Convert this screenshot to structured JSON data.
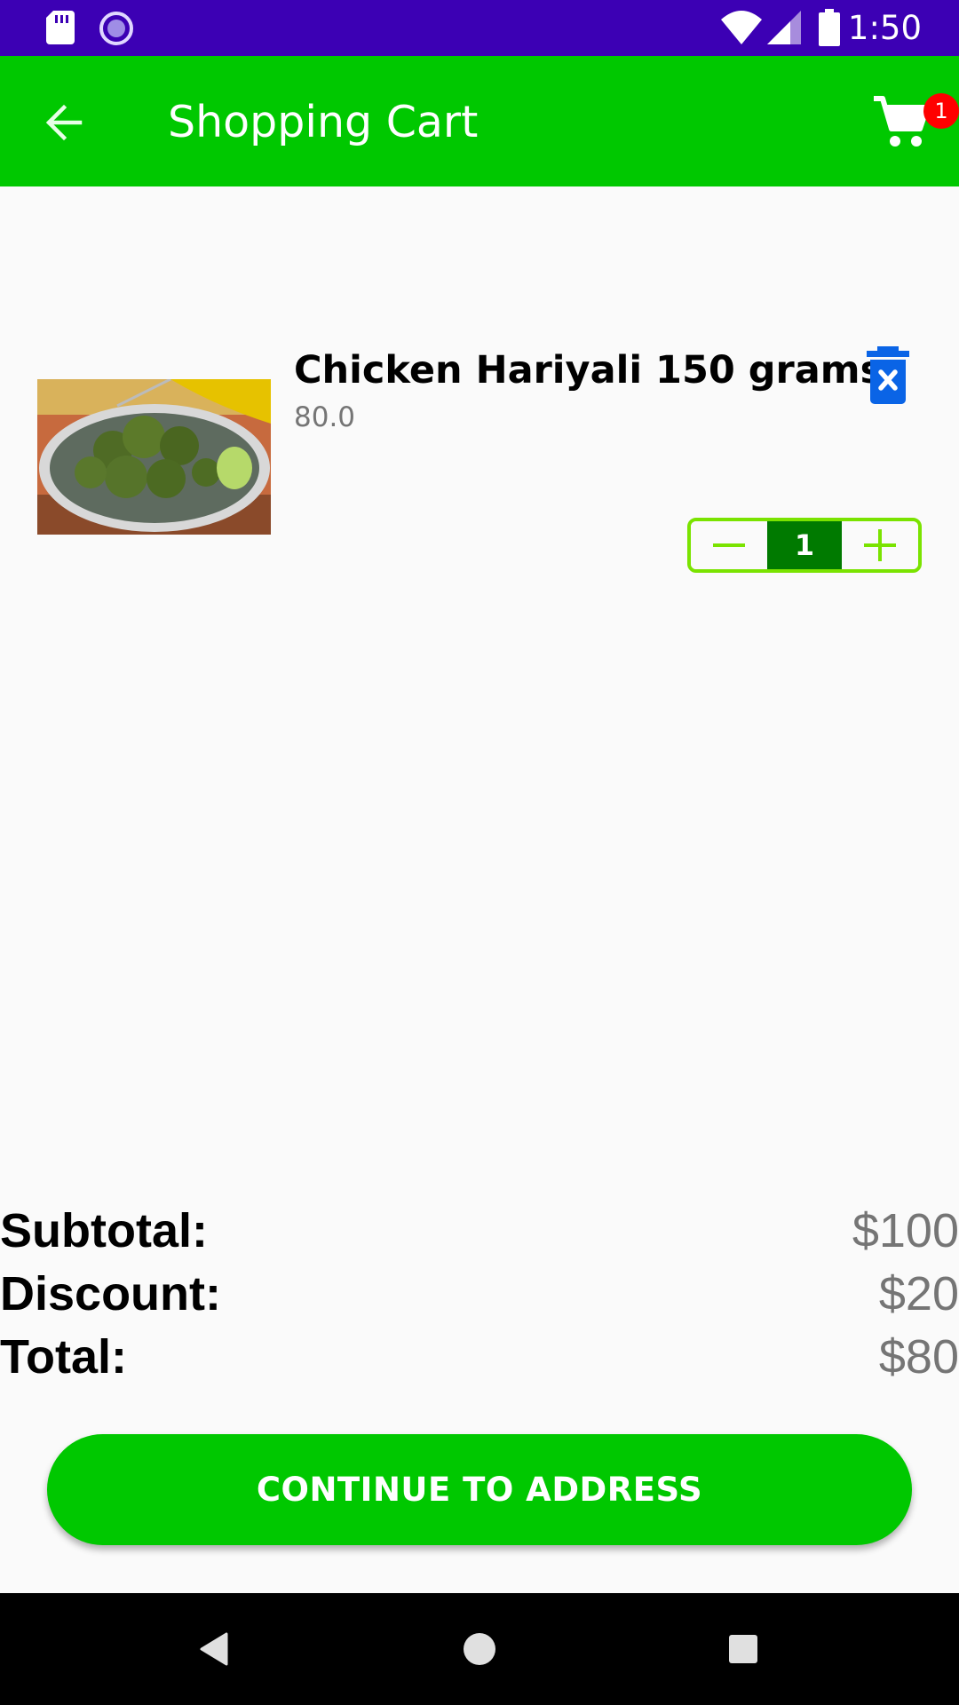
{
  "status_bar": {
    "time": "1:50",
    "icons": [
      "sd-card-icon",
      "sync-icon",
      "wifi-icon",
      "signal-icon",
      "battery-icon"
    ]
  },
  "app_bar": {
    "title": "Shopping Cart",
    "back_icon": "arrow-back-icon",
    "cart_icon": "shopping-cart-icon",
    "cart_badge": "1"
  },
  "cart": {
    "items": [
      {
        "name": "Chicken Hariyali 150 grams",
        "price": "80.0",
        "quantity": "1",
        "delete_icon": "delete-icon",
        "decrement_icon": "minus-icon",
        "increment_icon": "plus-icon"
      }
    ]
  },
  "summary": {
    "subtotal_label": "Subtotal:",
    "subtotal_value": "$100",
    "discount_label": "Discount:",
    "discount_value": "$20",
    "total_label": "Total:",
    "total_value": "$80"
  },
  "actions": {
    "continue_label": "CONTINUE TO ADDRESS"
  },
  "nav_bar": {
    "icons": [
      "back-nav-icon",
      "home-nav-icon",
      "recents-nav-icon"
    ]
  },
  "colors": {
    "status_bar": "#3c00b4",
    "primary": "#00c800",
    "stepper_border": "#7ae300",
    "stepper_qty_bg": "#007a00",
    "badge": "#ff0000",
    "delete_icon": "#0a64e6"
  }
}
